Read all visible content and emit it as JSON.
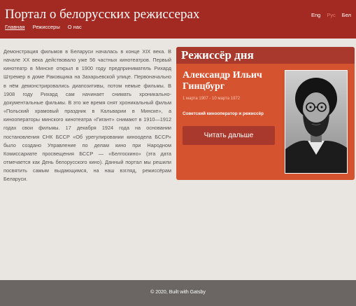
{
  "header": {
    "title": "Портал о белорусских режиссерах",
    "nav": [
      {
        "label": "Главная"
      },
      {
        "label": "Режиссеры"
      },
      {
        "label": "О нас"
      }
    ],
    "languages": [
      {
        "label": "Eng"
      },
      {
        "label": "Рус"
      },
      {
        "label": "Бел"
      }
    ]
  },
  "main": {
    "intro": "Демонстрация фильмов в Беларуси началась в конце XIX века. В начале XX века действовало уже 56 частных кинотеатров. Первый кинотеатр в Минске открыл в 1900 году предприниматель Рихард Штремер в доме Раковщика на Захарьевской улице. Первоначально в нём демонстрировались диапозитивы, потом немые фильмы. В 1908 году Рихард сам начинает снимать хроникально-документальные фильмы. В это же время снят хроникальный фильм «Польский храмовый праздник в Кальварии в Минске», а кинооператоры минского кинотеатра «Гигант» снимают в 1910—1912 годах свои фильмы. 17 декабря 1924 года на основании постановления СНК БССР «Об урегулировании киноодела БССР» было создано Управление по делам кино при Народном Комиссариате просвещения БССР — «Белгоскино» (эта дата отмечается как День белорусского кино). Данный портал мы решили посвятить самым выдающимся, на наш взгляд, режиссёрам Беларуси."
  },
  "director_of_day": {
    "heading": "Режиссёр дня",
    "name": "Александр Ильич Гинцбург",
    "dates": "1 марта 1907 - 10 марта 1972",
    "role": "Советский кинооператор и режиссёр",
    "button_label": "Читать дальше"
  },
  "footer": {
    "text": "© 2020, Built with Gatsby"
  },
  "colors": {
    "header_bg": "#a32a23",
    "card_bg": "#d65330",
    "card_head_bg": "#a8392c",
    "page_bg": "#e9e6e1",
    "footer_bg": "#6b6664"
  },
  "icons": {
    "portrait": "director-portrait-photo"
  }
}
